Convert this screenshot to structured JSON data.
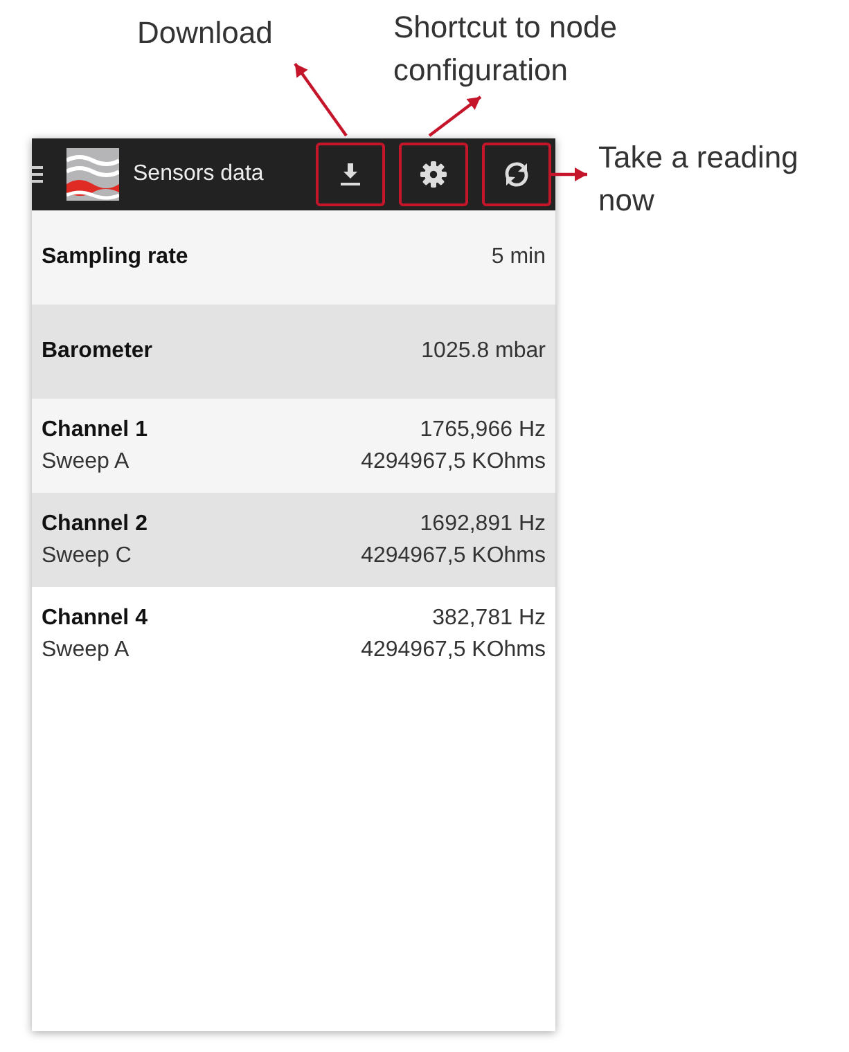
{
  "annotations": [
    {
      "text": "Download",
      "kind": "download"
    },
    {
      "text": "Shortcut to node configuration",
      "kind": "settings"
    },
    {
      "text": "Take a reading now",
      "kind": "refresh"
    }
  ],
  "app_bar": {
    "title": "Sensors data",
    "actions": [
      {
        "kind": "download",
        "highlighted": true
      },
      {
        "kind": "settings",
        "highlighted": true
      },
      {
        "kind": "refresh",
        "highlighted": true
      }
    ]
  },
  "rows": [
    {
      "label": "Sampling rate",
      "value": "5 min"
    },
    {
      "label": "Barometer",
      "value": "1025.8 mbar"
    },
    {
      "label": "Channel 1",
      "value": "1765,966 Hz",
      "sub_label": "Sweep A",
      "sub_value": "4294967,5 KOhms"
    },
    {
      "label": "Channel 2",
      "value": "1692,891 Hz",
      "sub_label": "Sweep C",
      "sub_value": "4294967,5 KOhms"
    },
    {
      "label": "Channel 4",
      "value": "382,781 Hz",
      "sub_label": "Sweep A",
      "sub_value": "4294967,5 KOhms"
    }
  ]
}
